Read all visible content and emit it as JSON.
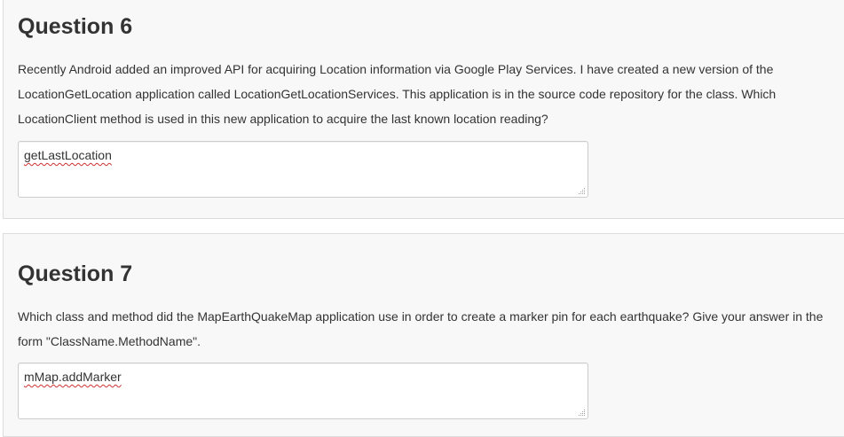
{
  "questions": [
    {
      "title": "Question 6",
      "text": "Recently Android added an improved API for acquiring Location information via Google Play Services. I have created a new version of the LocationGetLocation application called LocationGetLocationServices. This application is in the source code repository for the class. Which LocationClient method is used in this new application to acquire the last known location reading?",
      "answer": "getLastLocation"
    },
    {
      "title": "Question 7",
      "text": "Which class and method did the MapEarthQuakeMap application use in order to create a marker pin for each earthquake? Give your answer in the form \"ClassName.MethodName\".",
      "answer": "mMap.addMarker"
    }
  ],
  "colors": {
    "card_background": "#f8f8f8",
    "card_border": "#dcdcdc",
    "text": "#333333",
    "spellcheck_underline": "#d03030"
  },
  "icons": {
    "resize_grip": "resize-grip-icon"
  }
}
